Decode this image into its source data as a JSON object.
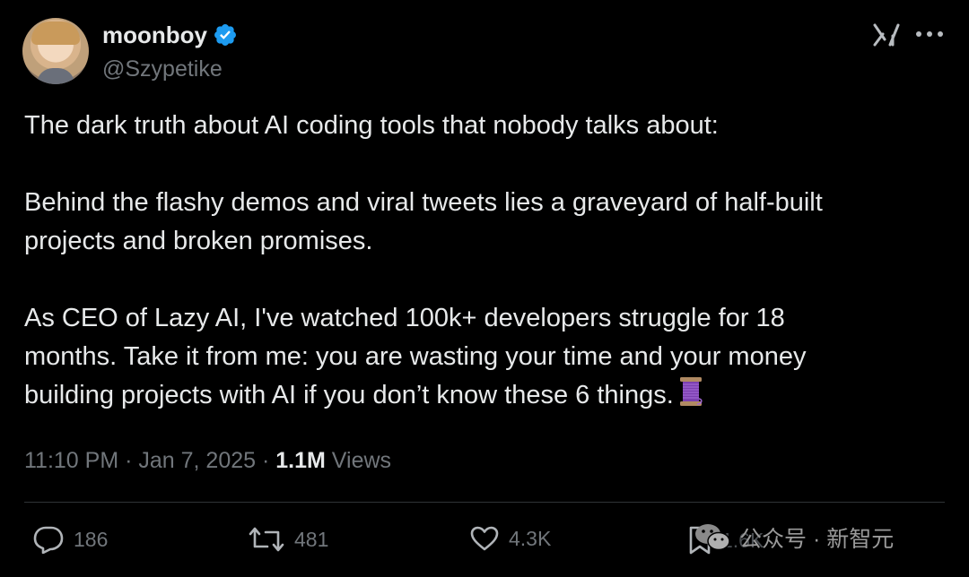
{
  "author": {
    "display_name": "moonboy",
    "handle": "@Szypetike",
    "verified_icon": "verified-badge-icon"
  },
  "header_icons": [
    "xai-logo",
    "more-icon"
  ],
  "tweet": {
    "text": "The dark truth about AI coding tools that nobody talks about:\n\nBehind the flashy demos and viral tweets lies a graveyard of half-built\nprojects and broken promises.\n\nAs CEO of Lazy AI, I've watched 100k+ developers struggle for 18\nmonths. Take it from me: you are wasting your time and your money\nbuilding projects with AI if you don’t know these 6 things.",
    "emoji": "thread-spool-icon"
  },
  "meta": {
    "time": "11:10 PM",
    "sep1": " · ",
    "date": "Jan 7, 2025",
    "sep2": " · ",
    "views_count": "1.1M",
    "views_label": " Views"
  },
  "actions": {
    "replies": "186",
    "reposts": "481",
    "likes": "4.3K",
    "bookmark_count": "1.6K"
  },
  "watermark": {
    "text": "公众号 · 新智元",
    "icon": "wechat-icon"
  },
  "colors": {
    "background": "#000000",
    "text": "#e7e9ea",
    "muted": "#71767b",
    "verified": "#1d9bf0",
    "divider": "#2f3336"
  }
}
